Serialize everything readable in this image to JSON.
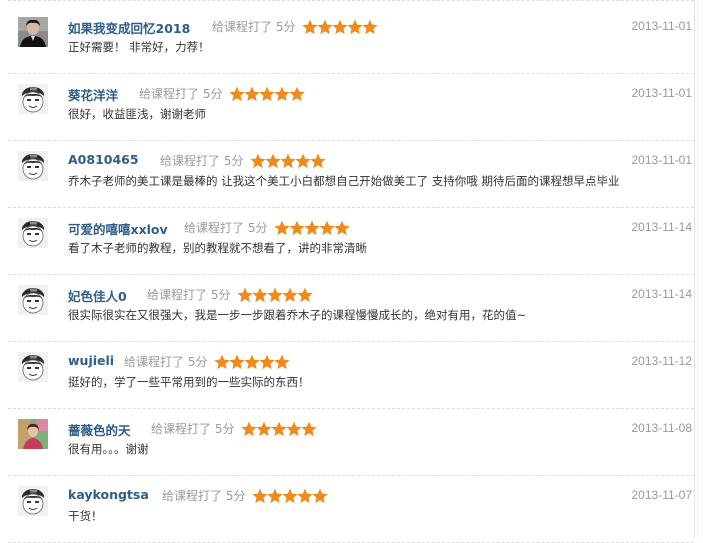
{
  "reviews": [
    {
      "name": "如果我变成回忆2018",
      "rating_text": "给课程打了 5分",
      "rating": 5,
      "date": "2013-11-01",
      "comment": "正好需要！ 非常好，力荐！",
      "avatar": "photo-dark-avatar"
    },
    {
      "name": "葵花洋洋",
      "rating_text": "给课程打了 5分",
      "rating": 5,
      "date": "2013-11-01",
      "comment": "很好，收益匪浅，谢谢老师",
      "avatar": "default-cartoon-avatar"
    },
    {
      "name": "A0810465",
      "rating_text": "给课程打了 5分",
      "rating": 5,
      "date": "2013-11-01",
      "comment": "乔木子老师的美工课是最棒的 让我这个美工小白都想自己开始做美工了 支持你哦 期待后面的课程想早点毕业",
      "avatar": "default-cartoon-avatar"
    },
    {
      "name": "可爱的嘻嘻xxlov",
      "rating_text": "给课程打了 5分",
      "rating": 5,
      "date": "2013-11-14",
      "comment": "看了木子老师的教程，别的教程就不想看了，讲的非常清晰",
      "avatar": "default-cartoon-avatar"
    },
    {
      "name": "妃色佳人0",
      "rating_text": "给课程打了 5分",
      "rating": 5,
      "date": "2013-11-14",
      "comment": "很实际很实在又很强大，我是一步一步跟着乔木子的课程慢慢成长的，绝对有用，花的值~",
      "avatar": "default-cartoon-avatar"
    },
    {
      "name": "wujieli",
      "rating_text": "给课程打了 5分",
      "rating": 5,
      "date": "2013-11-12",
      "comment": "挺好的，学了一些平常用到的一些实际的东西！",
      "avatar": "default-cartoon-avatar"
    },
    {
      "name": "蔷薇色的天",
      "rating_text": "给课程打了 5分",
      "rating": 5,
      "date": "2013-11-08",
      "comment": "很有用。。。谢谢",
      "avatar": "photo-colorful-avatar"
    },
    {
      "name": "kaykongtsa",
      "rating_text": "给课程打了 5分",
      "rating": 5,
      "date": "2013-11-07",
      "comment": "干货！",
      "avatar": "default-cartoon-avatar"
    }
  ],
  "colors": {
    "star": "#f08a1c",
    "username": "#2e5d8a",
    "meta": "#9a9a9a",
    "comment": "#333333"
  }
}
